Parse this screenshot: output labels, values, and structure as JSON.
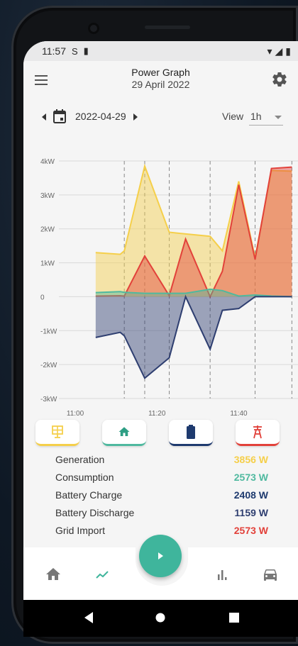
{
  "status_bar": {
    "time": "11:57"
  },
  "app_bar": {
    "title": "Power Graph",
    "subtitle": "29 April 2022"
  },
  "date_bar": {
    "date": "2022-04-29",
    "view_label": "View",
    "view_value": "1h"
  },
  "colors": {
    "generation": "#f5cf4a",
    "consumption": "#4fb99f",
    "battery_charge": "#1e3a6e",
    "battery_discharge": "#2e3e70",
    "grid_import": "#e2413a",
    "accent": "#3fb59c"
  },
  "chart_data": {
    "type": "area",
    "x": [
      "11:05",
      "11:11",
      "11:12",
      "11:17",
      "11:23",
      "11:27",
      "11:33",
      "11:36",
      "11:40",
      "11:44",
      "11:48",
      "11:53"
    ],
    "xticks": [
      "11:00",
      "11:20",
      "11:40"
    ],
    "yticks": [
      "4kW",
      "3kW",
      "2kW",
      "1kW",
      "0",
      "-1kW",
      "-2kW",
      "-3kW"
    ],
    "ylim": [
      -3,
      4
    ],
    "series": [
      {
        "name": "Generation",
        "color": "#f5cf4a",
        "values": [
          1.3,
          1.25,
          1.35,
          3.85,
          1.9,
          1.85,
          1.78,
          1.35,
          3.4,
          1.15,
          3.72,
          3.7
        ]
      },
      {
        "name": "Grid Import",
        "color": "#e2413a",
        "values": [
          0.02,
          0.03,
          0.02,
          1.2,
          0.03,
          1.7,
          0.0,
          0.75,
          3.3,
          1.1,
          3.78,
          3.82
        ]
      },
      {
        "name": "Consumption",
        "color": "#4fb99f",
        "values": [
          0.12,
          0.15,
          0.13,
          0.1,
          0.1,
          0.1,
          0.22,
          0.18,
          0.02,
          0.05,
          0.02,
          0.0
        ]
      },
      {
        "name": "Battery Discharge",
        "color": "#2e3e70",
        "values": [
          -1.2,
          -1.05,
          -1.15,
          -2.4,
          -1.8,
          0.0,
          -1.55,
          -0.4,
          -0.35,
          0.0,
          0.0,
          0.0
        ]
      }
    ]
  },
  "categories": [
    {
      "name": "generation",
      "icon": "solar-panel-icon"
    },
    {
      "name": "consumption",
      "icon": "home-icon"
    },
    {
      "name": "battery",
      "icon": "battery-icon"
    },
    {
      "name": "grid",
      "icon": "grid-tower-icon"
    }
  ],
  "legend": [
    {
      "label": "Generation",
      "value": "3856 W"
    },
    {
      "label": "Consumption",
      "value": "2573 W"
    },
    {
      "label": "Battery Charge",
      "value": "2408 W"
    },
    {
      "label": "Battery Discharge",
      "value": "1159 W"
    },
    {
      "label": "Grid Import",
      "value": "2573 W"
    }
  ]
}
